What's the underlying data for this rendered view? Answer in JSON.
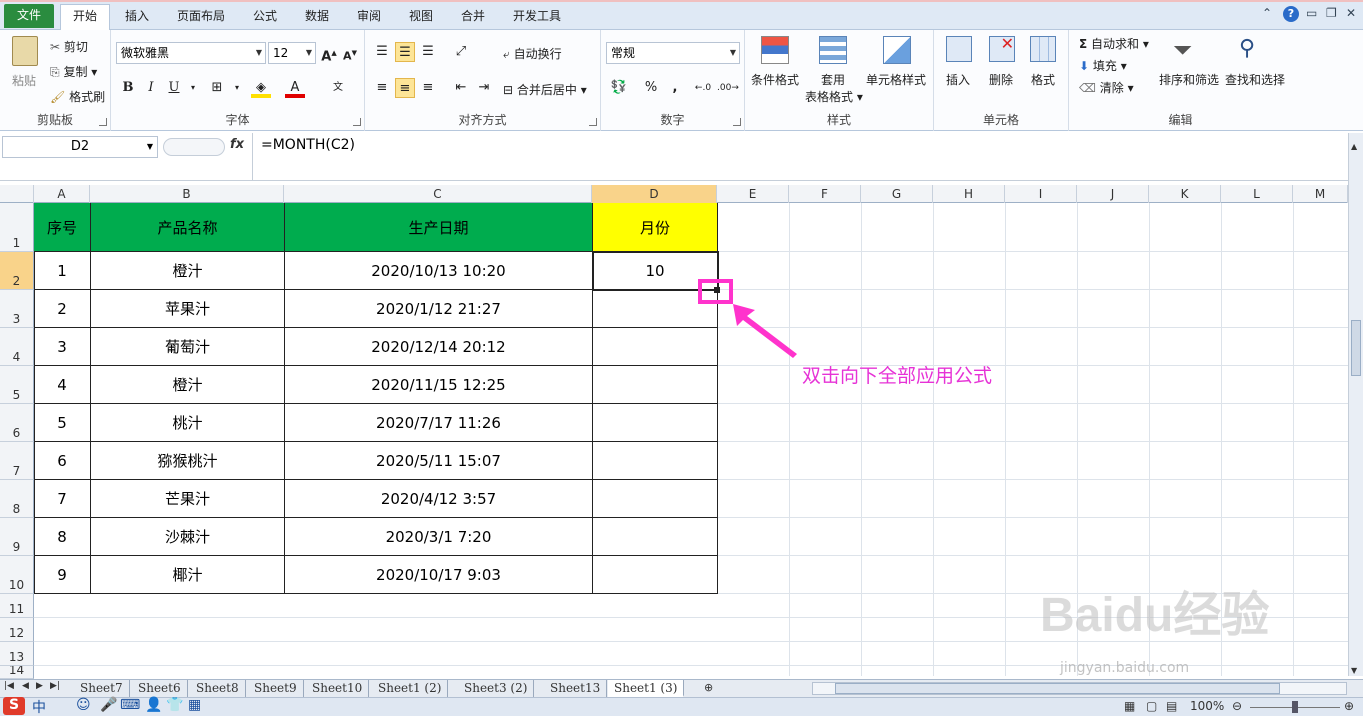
{
  "ribbon_tabs": [
    "文件",
    "开始",
    "插入",
    "页面布局",
    "公式",
    "数据",
    "审阅",
    "视图",
    "合并",
    "开发工具"
  ],
  "clipboard": {
    "paste": "粘贴",
    "cut": "剪切",
    "copy": "复制",
    "format_painter": "格式刷",
    "label": "剪贴板"
  },
  "font": {
    "name": "微软雅黑",
    "size": "12",
    "label": "字体",
    "bold": "B",
    "italic": "I",
    "underline": "U"
  },
  "alignment": {
    "wrap": "自动换行",
    "merge": "合并后居中",
    "label": "对齐方式"
  },
  "number": {
    "format": "常规",
    "percent": "%",
    "comma": ",",
    "label": "数字"
  },
  "styles": {
    "conditional": "条件格式",
    "table_format_1": "套用",
    "table_format_2": "表格格式",
    "cell_styles": "单元格样式",
    "label": "样式"
  },
  "cells": {
    "insert": "插入",
    "delete": "删除",
    "format": "格式",
    "label": "单元格"
  },
  "editing": {
    "autosum": "自动求和",
    "fill": "填充",
    "clear": "清除",
    "sort_filter": "排序和筛选",
    "find_select": "查找和选择",
    "label": "编辑"
  },
  "formula_bar": {
    "name_box": "D2",
    "fx": "fx",
    "formula": "=MONTH(C2)"
  },
  "columns": [
    "A",
    "B",
    "C",
    "D",
    "E",
    "F",
    "G",
    "H",
    "I",
    "J",
    "K",
    "L",
    "M"
  ],
  "rows": [
    "1",
    "2",
    "3",
    "4",
    "5",
    "6",
    "7",
    "8",
    "9",
    "10",
    "11",
    "12",
    "13",
    "14"
  ],
  "table": {
    "headers": [
      "序号",
      "产品名称",
      "生产日期",
      "月份"
    ],
    "rows": [
      [
        "1",
        "橙汁",
        "2020/10/13 10:20",
        "10"
      ],
      [
        "2",
        "苹果汁",
        "2020/1/12 21:27",
        ""
      ],
      [
        "3",
        "葡萄汁",
        "2020/12/14 20:12",
        ""
      ],
      [
        "4",
        "橙汁",
        "2020/11/15 12:25",
        ""
      ],
      [
        "5",
        "桃汁",
        "2020/7/17 11:26",
        ""
      ],
      [
        "6",
        "猕猴桃汁",
        "2020/5/11 15:07",
        ""
      ],
      [
        "7",
        "芒果汁",
        "2020/4/12 3:57",
        ""
      ],
      [
        "8",
        "沙棘汁",
        "2020/3/1 7:20",
        ""
      ],
      [
        "9",
        "椰汁",
        "2020/10/17 9:03",
        ""
      ]
    ]
  },
  "annotation": "双击向下全部应用公式",
  "sheets": [
    "Sheet7",
    "Sheet6",
    "Sheet8",
    "Sheet9",
    "Sheet10",
    "Sheet1 (2)",
    "Sheet3 (2)",
    "Sheet13",
    "Sheet1 (3)"
  ],
  "active_sheet": "Sheet1 (3)",
  "zoom": "100%",
  "ime": "中",
  "watermark": "Baidu经验",
  "watermark_url": "jingyan.baidu.com",
  "colors": {
    "header_green": "#00ac4e",
    "header_yellow": "#ffff00",
    "annotation": "#ff33cc"
  }
}
